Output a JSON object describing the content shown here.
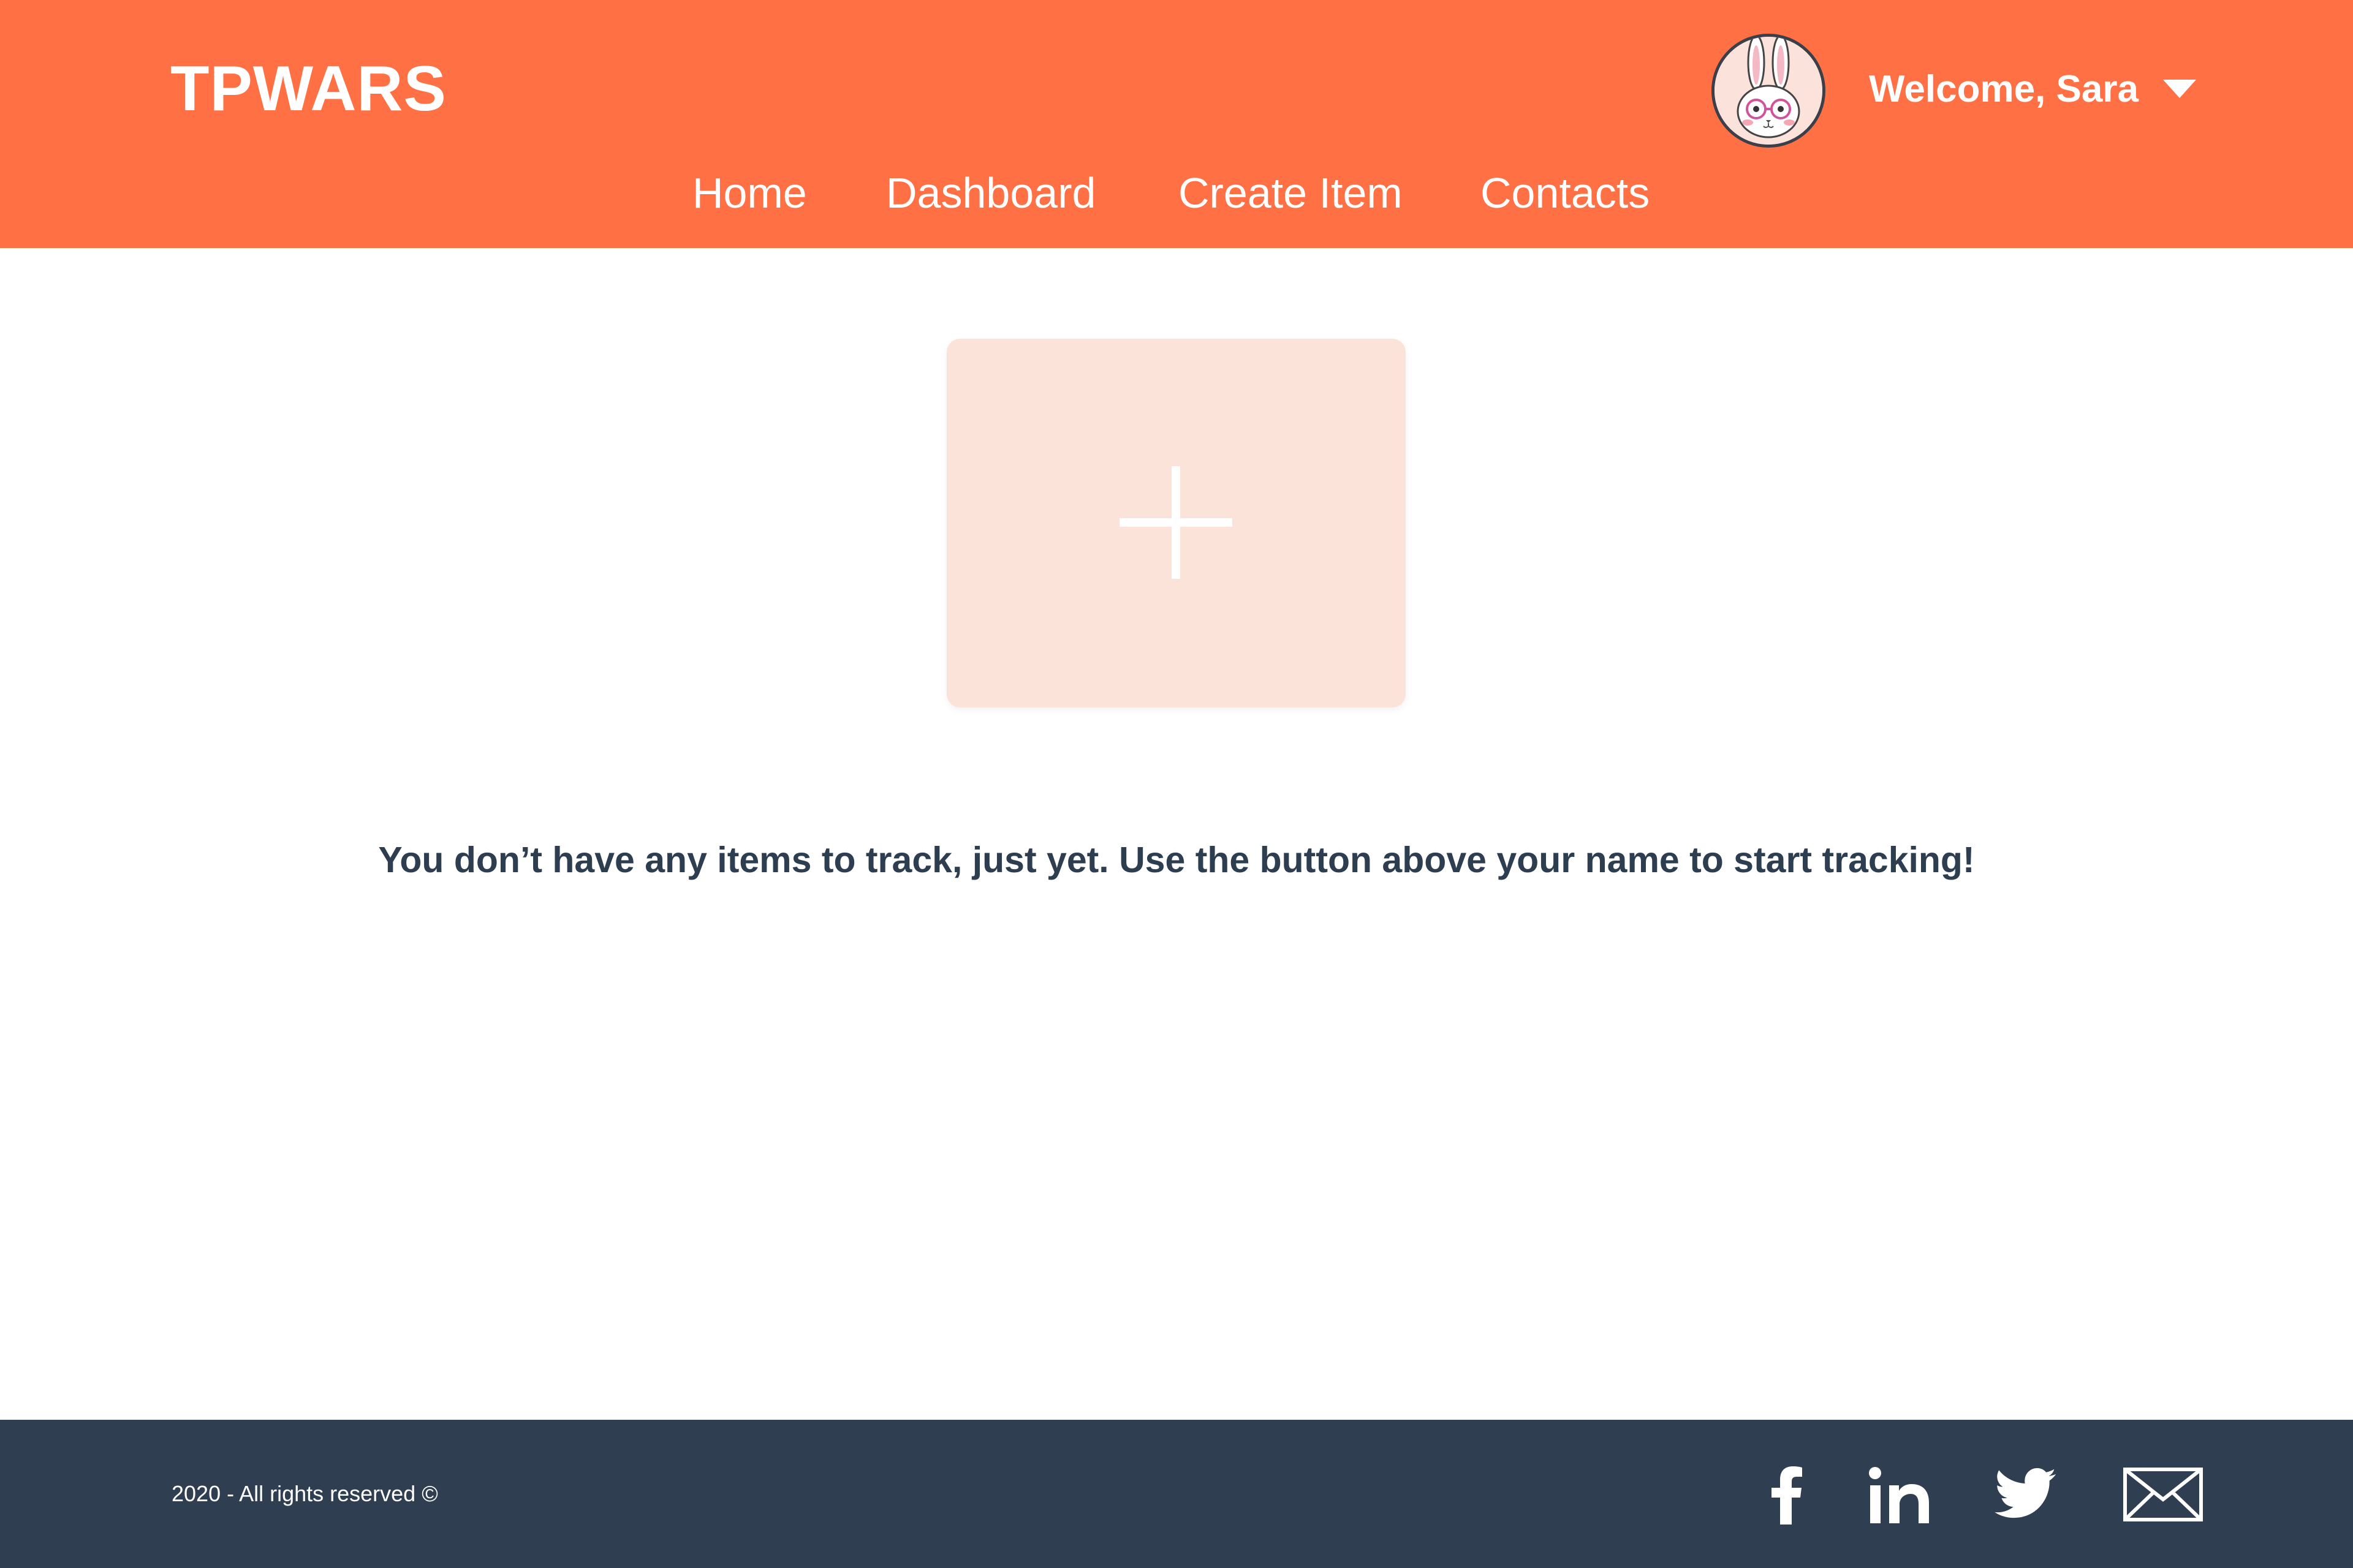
{
  "header": {
    "logo": "TPWARS",
    "welcome": "Welcome, Sara",
    "nav": [
      "Home",
      "Dashboard",
      "Create Item",
      "Contacts"
    ],
    "background_color": "#FF7145"
  },
  "main": {
    "add_card_color": "#FBE3DA",
    "empty_message": "You don’t have any items to track, just yet. Use the button above your name to start tracking!"
  },
  "footer": {
    "copyright": "2020 - All rights reserved ©",
    "social_icons": [
      "facebook-icon",
      "linkedin-icon",
      "twitter-icon",
      "mail-icon"
    ],
    "background_color": "#2F3E51"
  }
}
